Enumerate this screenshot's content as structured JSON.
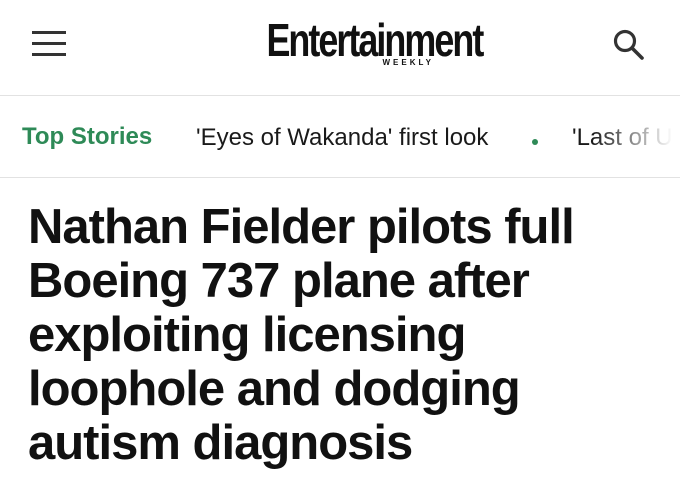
{
  "header": {
    "menu_icon": "hamburger-menu-icon",
    "logo_text": "Entertainment",
    "logo_subtext": "WEEKLY",
    "search_icon": "search-icon"
  },
  "nav": {
    "title": "Top Stories",
    "links": [
      "'Eyes of Wakanda' first look",
      "'Last of U"
    ],
    "separator_color": "#2e8a57"
  },
  "article": {
    "headline": "Nathan Fielder pilots full Boeing 737 plane after exploiting licensing loophole and dodging autism diagnosis"
  },
  "colors": {
    "accent": "#2e8a57",
    "text": "#111111",
    "divider": "#e2e2e2"
  }
}
